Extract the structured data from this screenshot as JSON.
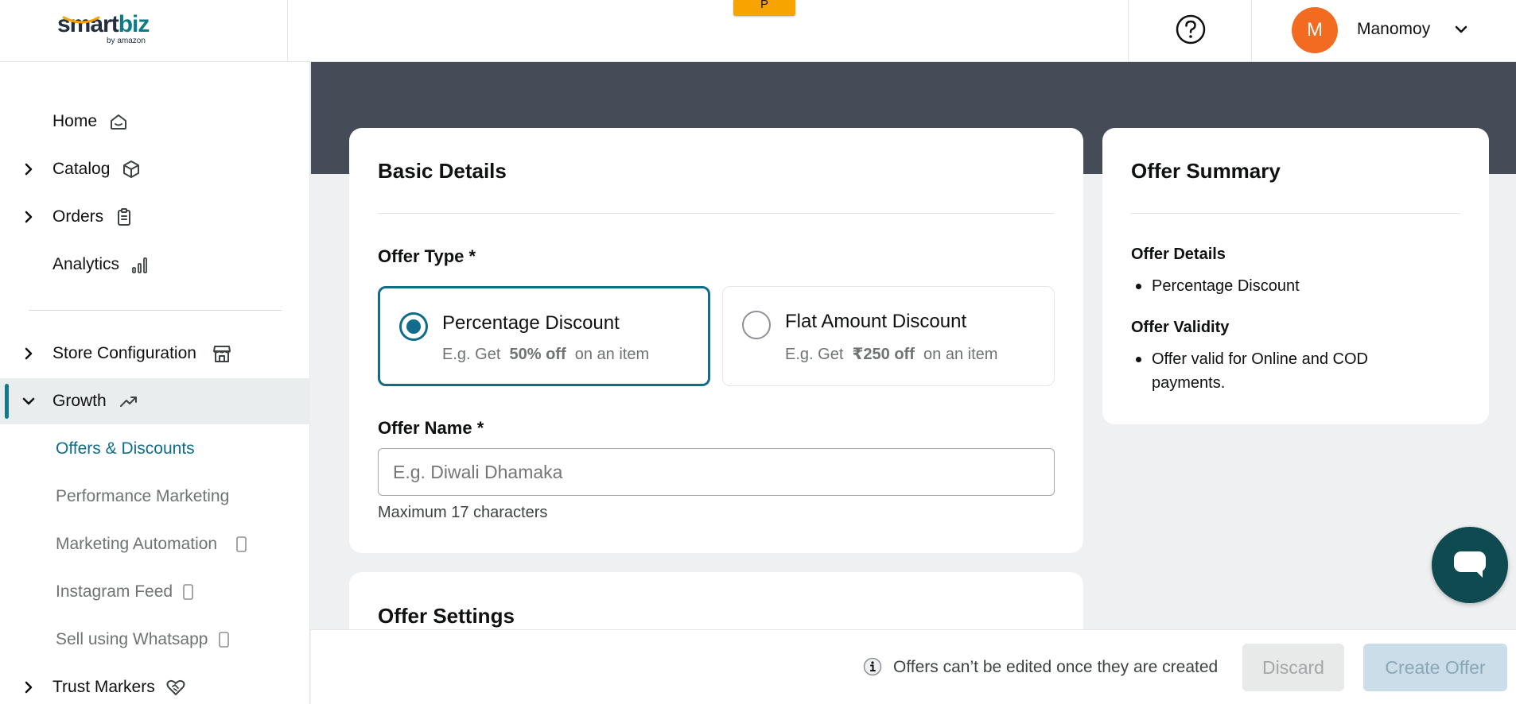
{
  "header": {
    "logo_text_smart": "smart",
    "logo_text_biz": "biz",
    "logo_byline": "by amazon",
    "env_tab_label": "P",
    "user_initial": "M",
    "user_name": "Manomoy"
  },
  "sidebar": {
    "items": [
      {
        "label": "Home",
        "icon": "home-icon"
      },
      {
        "label": "Catalog",
        "icon": "cube-icon"
      },
      {
        "label": "Orders",
        "icon": "clipboard-icon"
      },
      {
        "label": "Analytics",
        "icon": "bar-chart-icon"
      },
      {
        "label": "Store Configuration",
        "icon": "store-icon"
      },
      {
        "label": "Growth",
        "icon": "trending-up-icon"
      },
      {
        "label": "Trust Markers",
        "icon": "heart-handshake-icon"
      }
    ],
    "growth_sub_items": [
      {
        "label": "Offers & Discounts"
      },
      {
        "label": "Performance Marketing"
      },
      {
        "label": "Marketing Automation"
      },
      {
        "label": "Instagram Feed"
      },
      {
        "label": "Sell using Whatsapp"
      }
    ]
  },
  "basic_details": {
    "title": "Basic Details",
    "offer_type_label": "Offer Type *",
    "options": [
      {
        "title": "Percentage Discount",
        "sub_prefix": "E.g. Get",
        "sub_bold": "50% off",
        "sub_suffix": "on an item",
        "selected": true
      },
      {
        "title": "Flat Amount Discount",
        "sub_prefix": "E.g. Get",
        "sub_bold": "₹250 off",
        "sub_suffix": "on an item",
        "selected": false
      }
    ],
    "offer_name_label": "Offer Name *",
    "offer_name_value": "",
    "offer_name_placeholder": "E.g. Diwali Dhamaka",
    "offer_name_hint": "Maximum 17 characters"
  },
  "offer_settings": {
    "title": "Offer Settings"
  },
  "summary": {
    "title": "Offer Summary",
    "details_heading": "Offer Details",
    "details_items": [
      "Percentage Discount"
    ],
    "validity_heading": "Offer Validity",
    "validity_items": [
      "Offer valid for Online and COD payments."
    ]
  },
  "footer": {
    "info_text": "Offers can’t be edited once they are created",
    "discard_label": "Discard",
    "create_label": "Create Offer"
  },
  "colors": {
    "accent": "#0f6c8c",
    "banner": "#454c57",
    "avatar": "#f26b21",
    "env_tab": "#f7a300",
    "chat_fab": "#0e4a4f"
  }
}
